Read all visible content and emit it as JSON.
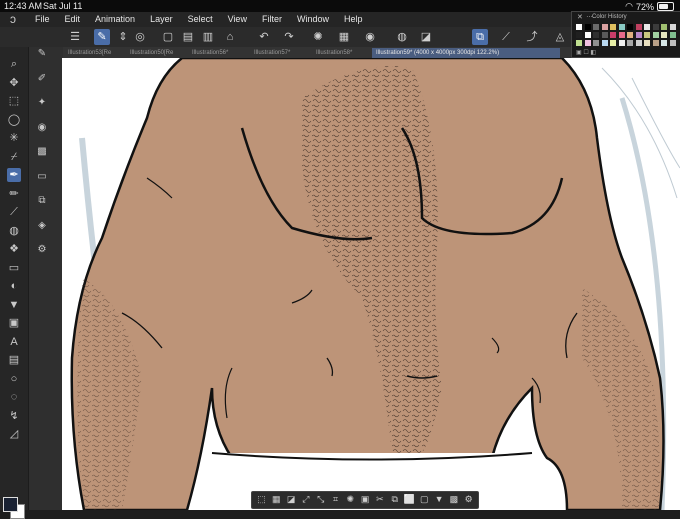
{
  "status": {
    "time": "12:43 AM",
    "date": "Sat Jul 11",
    "battery": "72%",
    "battery_level": 0.72
  },
  "app": {
    "logo": "clip-studio-icon"
  },
  "menu": [
    "File",
    "Edit",
    "Animation",
    "Layer",
    "Select",
    "View",
    "Filter",
    "Window",
    "Help"
  ],
  "tabs": [
    {
      "label": "Illustration53[Re"
    },
    {
      "label": "Illustration50[Re"
    },
    {
      "label": "Illustration56*"
    },
    {
      "label": "Illustration57*"
    },
    {
      "label": "Illustration58*"
    },
    {
      "label": "Illustration59* (4000 x 4000px 300dpi 122.2%)",
      "active": true
    }
  ],
  "color_history": {
    "title": "Color History",
    "swatches": [
      "#ffffff",
      "#000000",
      "#6b6b6b",
      "#d9a0a0",
      "#e0c060",
      "#88c9c2",
      "#000000",
      "#c04060",
      "#e8e8e8",
      "#3c3c3c",
      "#a0c070",
      "#d8d8d8",
      "#202020",
      "#ffffff",
      "#303030",
      "#5a5a5a",
      "#c83c6a",
      "#e86a8a",
      "#e0b080",
      "#b888c8",
      "#c8c880",
      "#a0d0a0",
      "#e8e8c0",
      "#80c090",
      "#c0e090",
      "#f0c0e0",
      "#909090",
      "#b8d8f0",
      "#e8f0a8",
      "#f0f0f0",
      "#a8a8a8",
      "#d0d0d0",
      "#e8e0c0",
      "#b8a088",
      "#d8e8e8",
      "#c0c0c0"
    ]
  },
  "colors": {
    "skin": "#bd9478",
    "accent": "#4a6da8",
    "fg_color": "#1a2233",
    "bg_color": "#ffffff"
  },
  "icons": {
    "toolbar": [
      "menu-icon",
      "pen-icon",
      "stepper-icon",
      "layer-icon",
      "new-file-icon",
      "open-file-icon",
      "save-icon",
      "hand-icon",
      "undo-icon",
      "redo-icon",
      "transform-icon",
      "select-icon",
      "lasso-icon",
      "fill-icon",
      "invert-icon",
      "border-icon",
      "ruler-icon",
      "ruler-curve-icon",
      "ruler-perspective-icon",
      "ruler-special-icon"
    ],
    "tools": [
      "zoom-icon",
      "move-icon",
      "selection-icon",
      "lasso-tool-icon",
      "wand-icon",
      "eyedropper-icon",
      "pen-tool-icon",
      "pencil-icon",
      "brush-icon",
      "airbrush-icon",
      "decoration-icon",
      "eraser-icon",
      "blend-icon",
      "fill-tool-icon",
      "gradient-icon",
      "text-icon",
      "frame-icon",
      "ellipse-icon",
      "balloon-icon",
      "correction-icon",
      "ruler-tool-icon"
    ],
    "subtools": [
      "pen-sub-icon",
      "marker-icon",
      "effect-icon",
      "dot-icon",
      "tone-icon",
      "folder-icon",
      "copy-icon",
      "layers-icon",
      "settings-icon"
    ],
    "bottom": [
      "clear-icon",
      "fill-sel-icon",
      "invert-sel-icon",
      "expand-icon",
      "shrink-icon",
      "crop-icon",
      "select-all-icon",
      "deselect-icon",
      "cut-icon",
      "copy-sel-icon",
      "transform-sel-icon",
      "border-sel-icon",
      "fill-bucket-icon",
      "tone-sel-icon",
      "settings-sel-icon"
    ]
  }
}
